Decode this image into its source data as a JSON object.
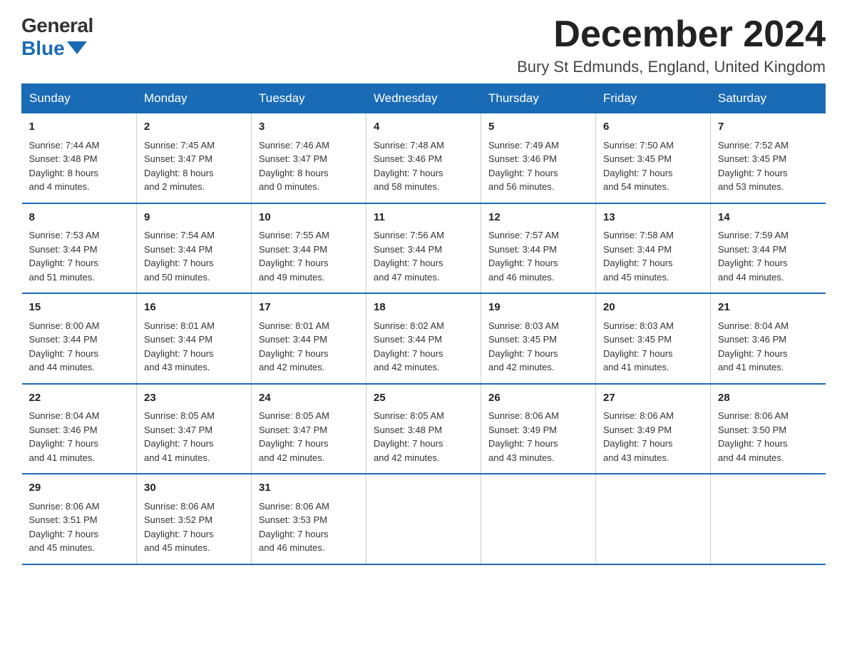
{
  "logo": {
    "general": "General",
    "blue": "Blue"
  },
  "header": {
    "month_year": "December 2024",
    "location": "Bury St Edmunds, England, United Kingdom"
  },
  "days_of_week": [
    "Sunday",
    "Monday",
    "Tuesday",
    "Wednesday",
    "Thursday",
    "Friday",
    "Saturday"
  ],
  "weeks": [
    [
      {
        "day": "1",
        "sunrise": "7:44 AM",
        "sunset": "3:48 PM",
        "daylight": "8 hours and 4 minutes."
      },
      {
        "day": "2",
        "sunrise": "7:45 AM",
        "sunset": "3:47 PM",
        "daylight": "8 hours and 2 minutes."
      },
      {
        "day": "3",
        "sunrise": "7:46 AM",
        "sunset": "3:47 PM",
        "daylight": "8 hours and 0 minutes."
      },
      {
        "day": "4",
        "sunrise": "7:48 AM",
        "sunset": "3:46 PM",
        "daylight": "7 hours and 58 minutes."
      },
      {
        "day": "5",
        "sunrise": "7:49 AM",
        "sunset": "3:46 PM",
        "daylight": "7 hours and 56 minutes."
      },
      {
        "day": "6",
        "sunrise": "7:50 AM",
        "sunset": "3:45 PM",
        "daylight": "7 hours and 54 minutes."
      },
      {
        "day": "7",
        "sunrise": "7:52 AM",
        "sunset": "3:45 PM",
        "daylight": "7 hours and 53 minutes."
      }
    ],
    [
      {
        "day": "8",
        "sunrise": "7:53 AM",
        "sunset": "3:44 PM",
        "daylight": "7 hours and 51 minutes."
      },
      {
        "day": "9",
        "sunrise": "7:54 AM",
        "sunset": "3:44 PM",
        "daylight": "7 hours and 50 minutes."
      },
      {
        "day": "10",
        "sunrise": "7:55 AM",
        "sunset": "3:44 PM",
        "daylight": "7 hours and 49 minutes."
      },
      {
        "day": "11",
        "sunrise": "7:56 AM",
        "sunset": "3:44 PM",
        "daylight": "7 hours and 47 minutes."
      },
      {
        "day": "12",
        "sunrise": "7:57 AM",
        "sunset": "3:44 PM",
        "daylight": "7 hours and 46 minutes."
      },
      {
        "day": "13",
        "sunrise": "7:58 AM",
        "sunset": "3:44 PM",
        "daylight": "7 hours and 45 minutes."
      },
      {
        "day": "14",
        "sunrise": "7:59 AM",
        "sunset": "3:44 PM",
        "daylight": "7 hours and 44 minutes."
      }
    ],
    [
      {
        "day": "15",
        "sunrise": "8:00 AM",
        "sunset": "3:44 PM",
        "daylight": "7 hours and 44 minutes."
      },
      {
        "day": "16",
        "sunrise": "8:01 AM",
        "sunset": "3:44 PM",
        "daylight": "7 hours and 43 minutes."
      },
      {
        "day": "17",
        "sunrise": "8:01 AM",
        "sunset": "3:44 PM",
        "daylight": "7 hours and 42 minutes."
      },
      {
        "day": "18",
        "sunrise": "8:02 AM",
        "sunset": "3:44 PM",
        "daylight": "7 hours and 42 minutes."
      },
      {
        "day": "19",
        "sunrise": "8:03 AM",
        "sunset": "3:45 PM",
        "daylight": "7 hours and 42 minutes."
      },
      {
        "day": "20",
        "sunrise": "8:03 AM",
        "sunset": "3:45 PM",
        "daylight": "7 hours and 41 minutes."
      },
      {
        "day": "21",
        "sunrise": "8:04 AM",
        "sunset": "3:46 PM",
        "daylight": "7 hours and 41 minutes."
      }
    ],
    [
      {
        "day": "22",
        "sunrise": "8:04 AM",
        "sunset": "3:46 PM",
        "daylight": "7 hours and 41 minutes."
      },
      {
        "day": "23",
        "sunrise": "8:05 AM",
        "sunset": "3:47 PM",
        "daylight": "7 hours and 41 minutes."
      },
      {
        "day": "24",
        "sunrise": "8:05 AM",
        "sunset": "3:47 PM",
        "daylight": "7 hours and 42 minutes."
      },
      {
        "day": "25",
        "sunrise": "8:05 AM",
        "sunset": "3:48 PM",
        "daylight": "7 hours and 42 minutes."
      },
      {
        "day": "26",
        "sunrise": "8:06 AM",
        "sunset": "3:49 PM",
        "daylight": "7 hours and 43 minutes."
      },
      {
        "day": "27",
        "sunrise": "8:06 AM",
        "sunset": "3:49 PM",
        "daylight": "7 hours and 43 minutes."
      },
      {
        "day": "28",
        "sunrise": "8:06 AM",
        "sunset": "3:50 PM",
        "daylight": "7 hours and 44 minutes."
      }
    ],
    [
      {
        "day": "29",
        "sunrise": "8:06 AM",
        "sunset": "3:51 PM",
        "daylight": "7 hours and 45 minutes."
      },
      {
        "day": "30",
        "sunrise": "8:06 AM",
        "sunset": "3:52 PM",
        "daylight": "7 hours and 45 minutes."
      },
      {
        "day": "31",
        "sunrise": "8:06 AM",
        "sunset": "3:53 PM",
        "daylight": "7 hours and 46 minutes."
      },
      null,
      null,
      null,
      null
    ]
  ],
  "labels": {
    "sunrise": "Sunrise:",
    "sunset": "Sunset:",
    "daylight": "Daylight:"
  }
}
